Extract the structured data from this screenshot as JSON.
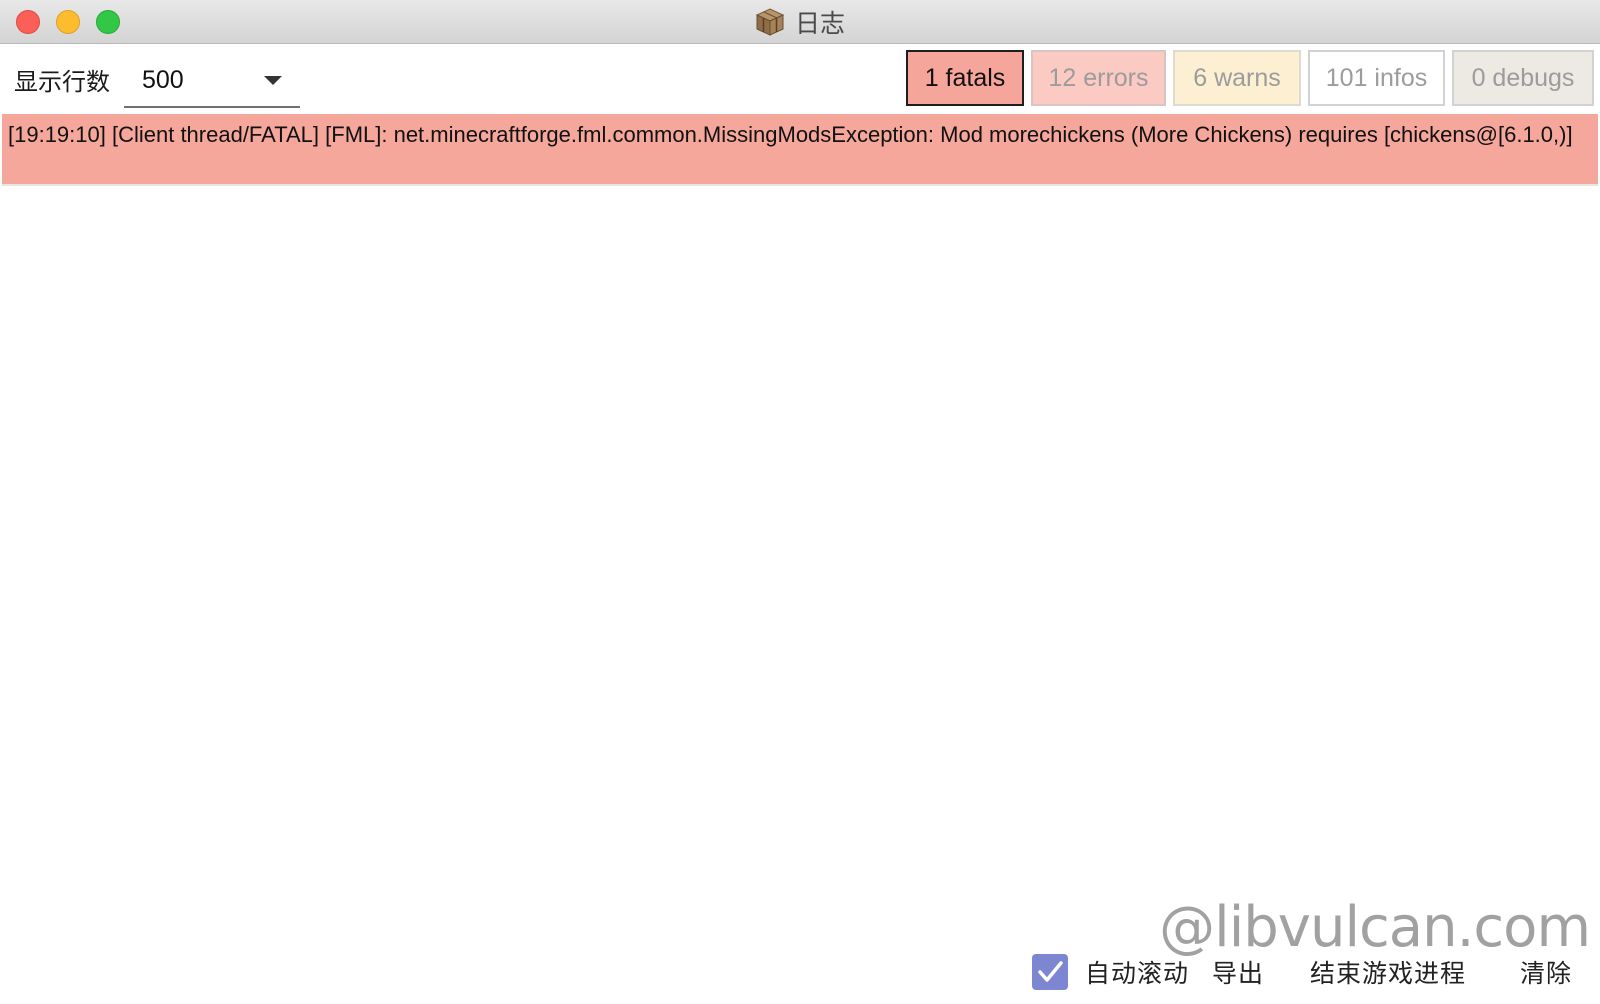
{
  "window": {
    "title": "日志",
    "icon": "crafting-table-icon"
  },
  "toolbar": {
    "rows_label": "显示行数",
    "rows_value": "500",
    "filters": {
      "fatal": "1 fatals",
      "error": "12 errors",
      "warn": "6 warns",
      "info": "101 infos",
      "debug": "0 debugs"
    }
  },
  "log": {
    "entries": [
      "[19:19:10] [Client thread/FATAL] [FML]: net.minecraftforge.fml.common.MissingModsException: Mod morechickens (More Chickens) requires [chickens@[6.1.0,)]"
    ]
  },
  "bottom": {
    "autoscroll_label": "自动滚动",
    "autoscroll_checked": true,
    "export_label": "导出",
    "kill_label": "结束游戏进程",
    "clear_label": "清除"
  },
  "watermark": "@libvulcan.com",
  "colors": {
    "fatal": "#f6a59b",
    "error": "#fbcac2",
    "warn": "#fcefd2",
    "info": "#ffffff",
    "debug": "#ede9e3",
    "checkbox": "#7d86d1"
  }
}
